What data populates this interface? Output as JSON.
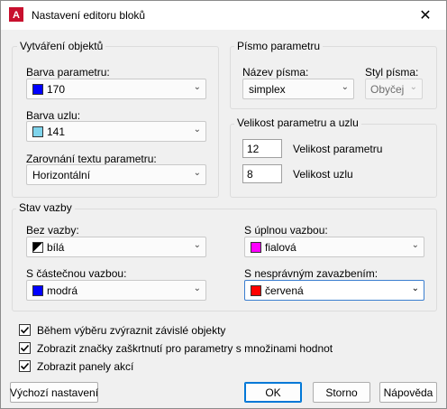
{
  "window": {
    "title": "Nastavení editoru bloků",
    "close_glyph": "✕",
    "app_icon": "autocad-logo-icon",
    "app_icon_letter": "A"
  },
  "groups": {
    "object_creation": {
      "title": "Vytváření objektů",
      "param_color": {
        "label": "Barva parametru:",
        "value": "170",
        "color": "#0000ff"
      },
      "node_color": {
        "label": "Barva uzlu:",
        "value": "141",
        "color": "#7fd4ec"
      },
      "text_align": {
        "label": "Zarovnání textu parametru:",
        "value": "Horizontální"
      }
    },
    "param_font": {
      "title": "Písmo parametru",
      "font_name": {
        "label": "Název písma:",
        "value": "simplex"
      },
      "font_style": {
        "label": "Styl písma:",
        "value": "Obyčej"
      }
    },
    "param_size": {
      "title": "Velikost parametru a uzlu",
      "param_size": {
        "value": "12",
        "label": "Velikost parametru"
      },
      "node_size": {
        "value": "8",
        "label": "Velikost uzlu"
      }
    },
    "constraint_state": {
      "title": "Stav vazby",
      "unconstrained": {
        "label": "Bez vazby:",
        "value": "bílá",
        "color": "diagonal-black-white"
      },
      "partial": {
        "label": "S částečnou vazbou:",
        "value": "modrá",
        "color": "#0000ff"
      },
      "full": {
        "label": "S úplnou vazbou:",
        "value": "fialová",
        "color": "#ff00ff"
      },
      "over": {
        "label": "S nesprávným zavazbením:",
        "value": "červená",
        "color": "#ff0000"
      }
    }
  },
  "checkboxes": [
    {
      "label": "Během výběru zvýraznit závislé objekty",
      "checked": true
    },
    {
      "label": "Zobrazit značky zaškrtnutí pro parametry s množinami hodnot",
      "checked": true
    },
    {
      "label": "Zobrazit panely akcí",
      "checked": true
    }
  ],
  "buttons": {
    "defaults": "Výchozí nastavení",
    "ok": "OK",
    "cancel": "Storno",
    "help": "Nápověda"
  },
  "icons": {
    "dropdown": "chevron-down-icon",
    "check": "checkmark-icon"
  }
}
